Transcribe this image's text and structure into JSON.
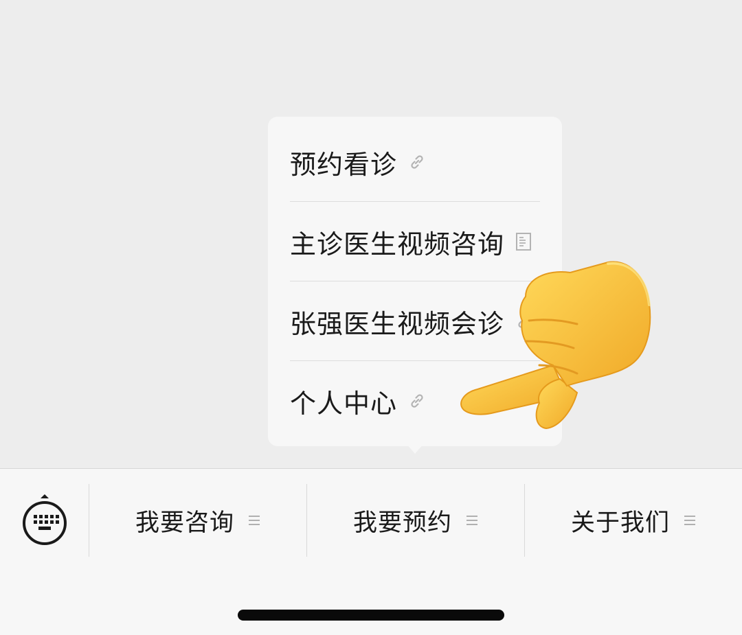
{
  "submenu": {
    "items": [
      {
        "label": "预约看诊",
        "icon": "link-icon"
      },
      {
        "label": "主诊医生视频咨询",
        "icon": "document-icon"
      },
      {
        "label": "张强医生视频会诊",
        "icon": "link-icon"
      },
      {
        "label": "个人中心",
        "icon": "link-icon"
      }
    ]
  },
  "bottom_menu": {
    "keyboard_icon": "keyboard-icon",
    "items": [
      {
        "label": "我要咨询",
        "icon": "menu-lines-icon"
      },
      {
        "label": "我要预约",
        "icon": "menu-lines-icon"
      },
      {
        "label": "关于我们",
        "icon": "menu-lines-icon"
      }
    ]
  },
  "overlay": {
    "icon": "pointing-hand-emoji"
  },
  "colors": {
    "chat_background": "#ededed",
    "menu_background": "#f7f7f7",
    "text": "#1a1a1a",
    "hand": "#f6c23c"
  }
}
